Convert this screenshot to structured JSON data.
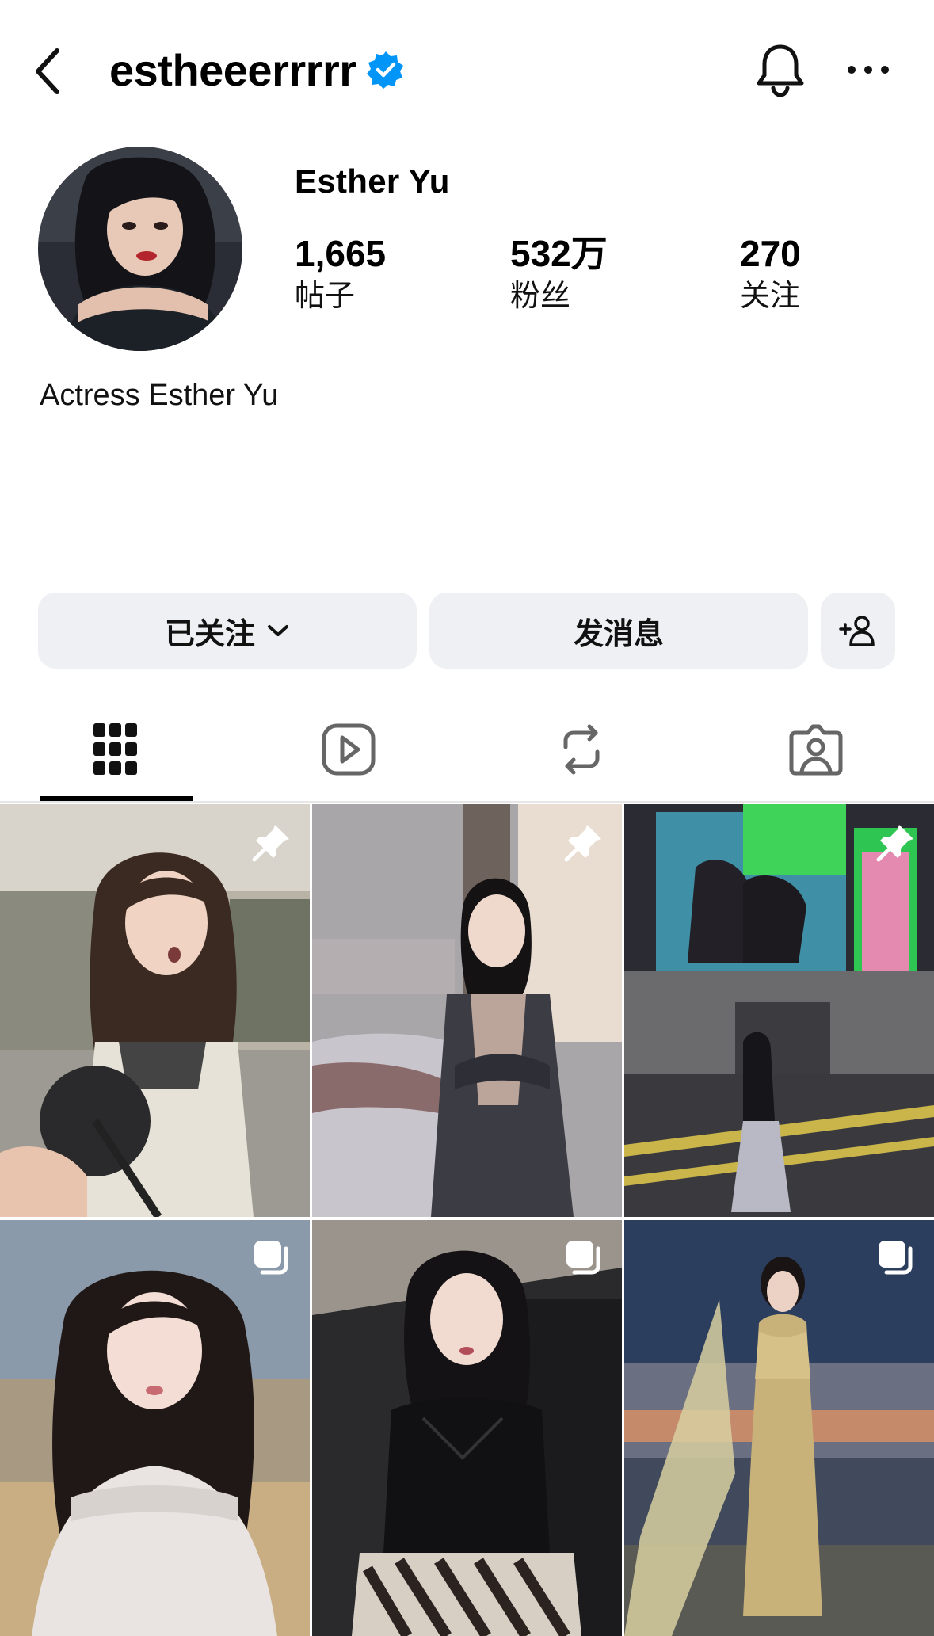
{
  "header": {
    "username": "estheeerrrrr",
    "verified": true,
    "icons": [
      "back-chevron-icon",
      "verified-badge-icon",
      "bell-icon",
      "more-horizontal-icon"
    ]
  },
  "profile": {
    "display_name": "Esther Yu",
    "bio": "Actress Esther Yu",
    "stats": [
      {
        "value": "1,665",
        "label": "帖子"
      },
      {
        "value": "532万",
        "label": "粉丝"
      },
      {
        "value": "270",
        "label": "关注"
      }
    ]
  },
  "actions": {
    "following_label": "已关注",
    "message_label": "发消息"
  },
  "tabs": [
    {
      "icon": "grid-icon",
      "active": true
    },
    {
      "icon": "reels-icon",
      "active": false
    },
    {
      "icon": "reposts-icon",
      "active": false
    },
    {
      "icon": "tagged-icon",
      "active": false
    }
  ],
  "posts": [
    {
      "badge": "pin-icon"
    },
    {
      "badge": "pin-icon"
    },
    {
      "badge": "pin-icon"
    },
    {
      "badge": "carousel-icon"
    },
    {
      "badge": "carousel-icon"
    },
    {
      "badge": "carousel-icon"
    }
  ],
  "colors": {
    "verified_blue": "#0095f6",
    "button_bg": "#eff0f3",
    "text": "#000000"
  }
}
